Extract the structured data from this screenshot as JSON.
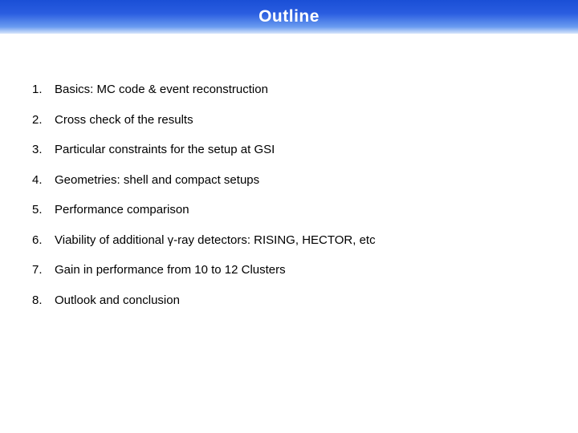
{
  "title": "Outline",
  "items": [
    "Basics: MC code & event reconstruction",
    "Cross check of the results",
    "Particular constraints for the setup at GSI",
    "Geometries: shell and compact setups",
    "Performance comparison",
    "Viability of additional γ-ray detectors: RISING, HECTOR, etc",
    "Gain in performance from 10 to 12 Clusters",
    "Outlook and conclusion"
  ]
}
